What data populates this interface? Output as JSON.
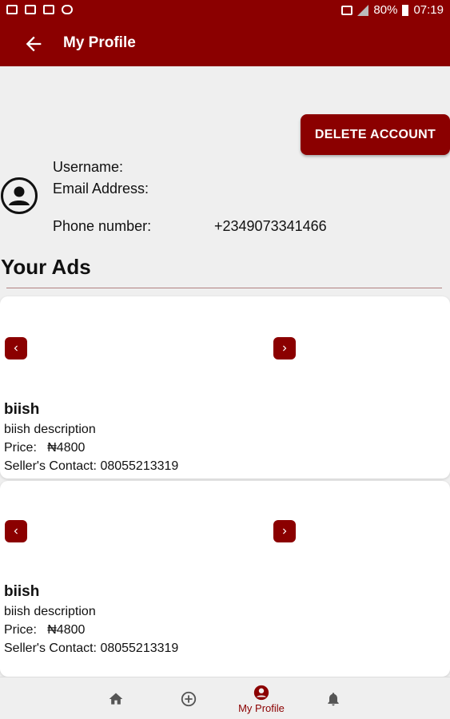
{
  "status_bar": {
    "battery": "80%",
    "time": "07:19",
    "notification_icons": [
      "notification-icon",
      "mail-icon",
      "gmail-icon",
      "sync-icon"
    ]
  },
  "app_bar": {
    "title": "My Profile"
  },
  "profile": {
    "delete_label": "DELETE ACCOUNT",
    "username_label": "Username:",
    "email_label": "Email Address:",
    "phone_label": "Phone number:",
    "phone_value": "+2349073341466"
  },
  "section_title": "Your Ads",
  "ads": [
    {
      "name": "biish",
      "description": "biish description",
      "price": "Price:   ₦4800",
      "contact": "Seller's Contact: 08055213319"
    },
    {
      "name": "biish",
      "description": "biish description",
      "price": "Price:   ₦4800",
      "contact": "Seller's Contact: 08055213319"
    }
  ],
  "bottom_nav": {
    "items": [
      {
        "icon": "home-icon",
        "label": ""
      },
      {
        "icon": "add-circle-icon",
        "label": ""
      },
      {
        "icon": "account-icon",
        "label": "My Profile",
        "active": true
      },
      {
        "icon": "bell-icon",
        "label": ""
      }
    ]
  },
  "colors": {
    "primary": "#8b0000",
    "background": "#efefef",
    "card": "#ffffff"
  }
}
